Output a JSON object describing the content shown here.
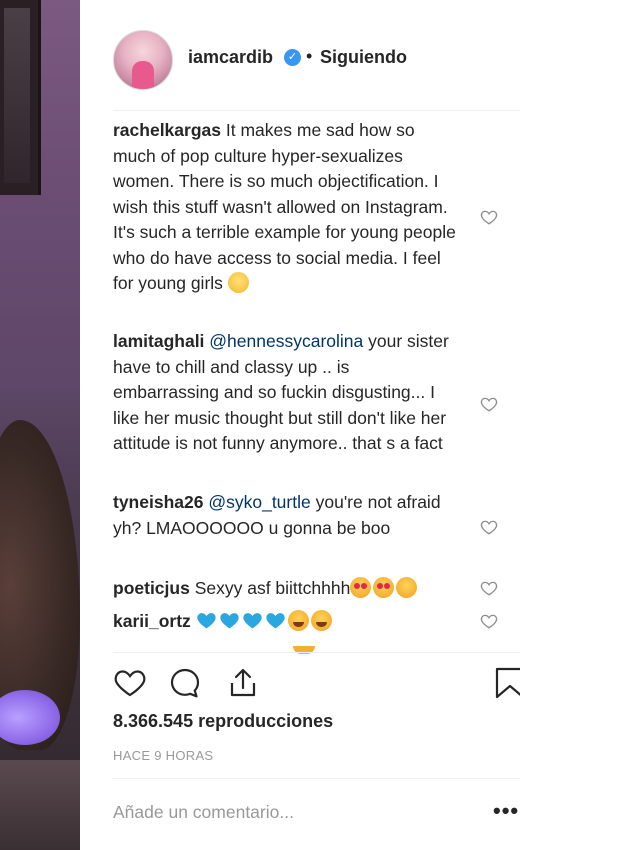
{
  "post": {
    "username": "iamcardib",
    "verified_icon": "check-badge-icon",
    "separator": "•",
    "follow_status": "Siguiendo"
  },
  "comments": [
    {
      "username": "rachelkargas",
      "text": "It makes me sad how so much of pop culture hyper-sexualizes women. There is so much objectification. I wish this stuff wasn't allowed on Instagram. It's such a terrible example for young people who do have access to social media. I feel for young girls",
      "emojis": [
        "sad-face-emoji"
      ]
    },
    {
      "username": "lamitaghali",
      "mention": "@hennessycarolina",
      "text": "your sister have to chill and classy up .. is embarrassing and so fuckin disgusting... I like her music thought but still don't like her attitude is not funny anymore.. that s a fact"
    },
    {
      "username": "tyneisha26",
      "mention": "@syko_turtle",
      "text": "you're not afraid yh? LMAOOOOOO u gonna be boo"
    },
    {
      "username": "poeticjus",
      "text": "Sexyy asf biittchhhh",
      "emojis": [
        "heart-eyes-emoji",
        "heart-eyes-emoji",
        "yum-face-emoji"
      ]
    },
    {
      "username": "karii_ortz",
      "text": "",
      "emojis": [
        "blue-heart-emoji",
        "blue-heart-emoji",
        "blue-heart-emoji",
        "blue-heart-emoji",
        "tears-of-joy-emoji",
        "tears-of-joy-emoji"
      ]
    }
  ],
  "stats": {
    "views": "8.366.545 reproducciones",
    "time_ago": "HACE 9 HORAS"
  },
  "comment_box": {
    "placeholder": "Añade un comentario...",
    "more_label": "•••"
  },
  "colors": {
    "verified": "#3897f0",
    "mention": "#003569",
    "text": "#262626",
    "muted": "#999999",
    "blue_heart": "#2aa7e0"
  }
}
